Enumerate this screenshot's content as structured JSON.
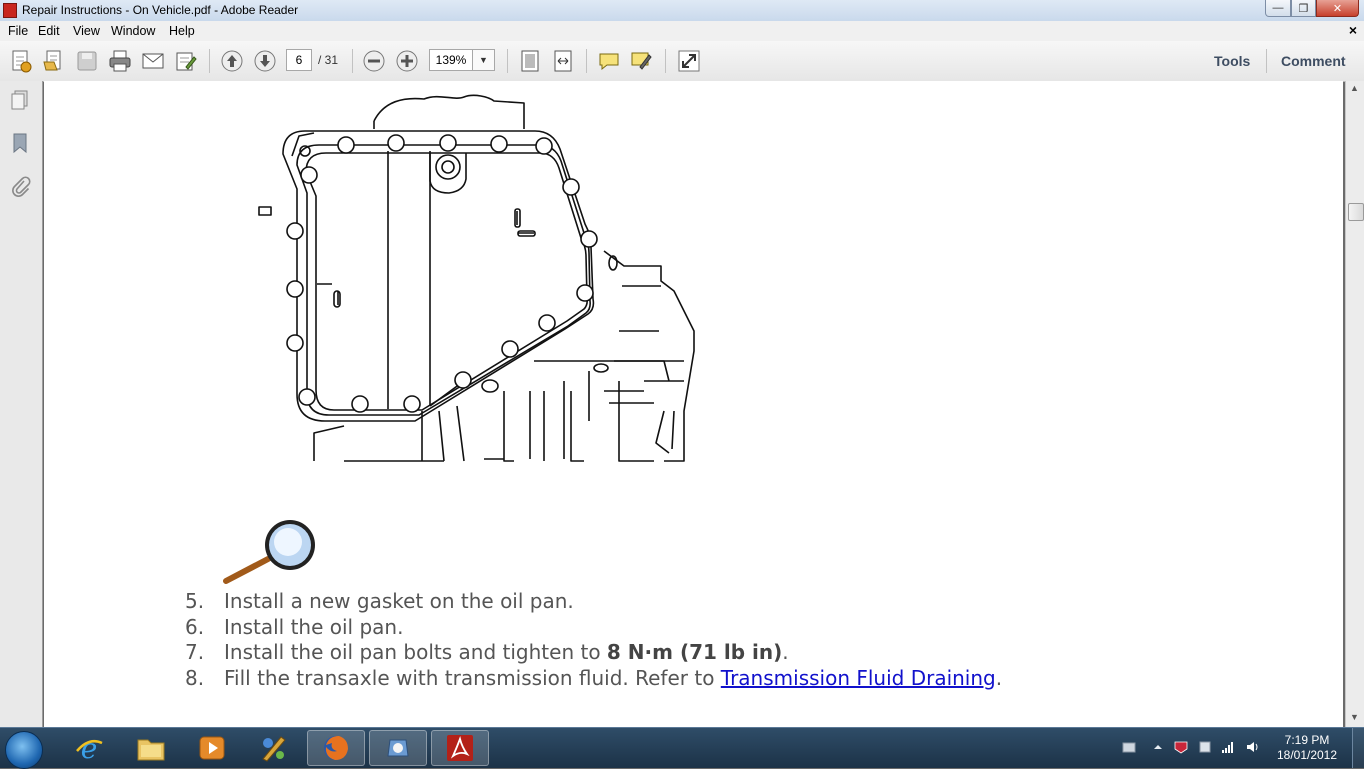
{
  "window": {
    "title": "Repair Instructions - On Vehicle.pdf - Adobe Reader",
    "minimize_glyph": "—",
    "maximize_glyph": "❐",
    "close_glyph": "✕"
  },
  "menubar": {
    "items": [
      "File",
      "Edit",
      "View",
      "Window",
      "Help"
    ],
    "close_glyph": "×"
  },
  "toolbar": {
    "current_page": "6",
    "page_total": "/ 31",
    "zoom": "139%",
    "zoom_dropdown_glyph": "▼",
    "tools_label": "Tools",
    "comment_label": "Comment"
  },
  "document": {
    "steps": [
      {
        "num": "5.",
        "text": "Install a new gasket on the oil pan."
      },
      {
        "num": "6.",
        "text": "Install the oil pan."
      },
      {
        "num": "7.",
        "text_before": "Install the oil pan bolts and tighten to ",
        "bold": "8 N·m (71 lb in)",
        "text_after": "."
      },
      {
        "num": "8.",
        "text_before": "Fill the transaxle with transmission fluid. Refer to ",
        "link": "Transmission Fluid Draining",
        "text_after": "."
      }
    ]
  },
  "scrollbar": {
    "up_glyph": "▲",
    "down_glyph": "▼"
  },
  "taskbar": {
    "clock_time": "7:19 PM",
    "clock_date": "18/01/2012"
  },
  "icons": {
    "nav": [
      "pages-icon",
      "bookmarks-icon",
      "attachments-icon"
    ],
    "toolbar": [
      "create-pdf-icon",
      "open-icon",
      "save-icon",
      "print-icon",
      "email-icon",
      "sign-icon",
      "previous-page-icon",
      "next-page-icon",
      "zoom-out-icon",
      "zoom-in-icon",
      "fit-page-icon",
      "fit-width-icon",
      "sticky-note-icon",
      "highlight-icon",
      "full-screen-icon"
    ],
    "taskbar": [
      "start-icon",
      "internet-explorer-icon",
      "file-explorer-icon",
      "media-player-icon",
      "paint-icon",
      "firefox-icon",
      "app-icon",
      "adobe-reader-icon"
    ]
  },
  "colors": {
    "link": "#1111cc",
    "body_text": "#555555",
    "taskbar": "#243e57"
  }
}
